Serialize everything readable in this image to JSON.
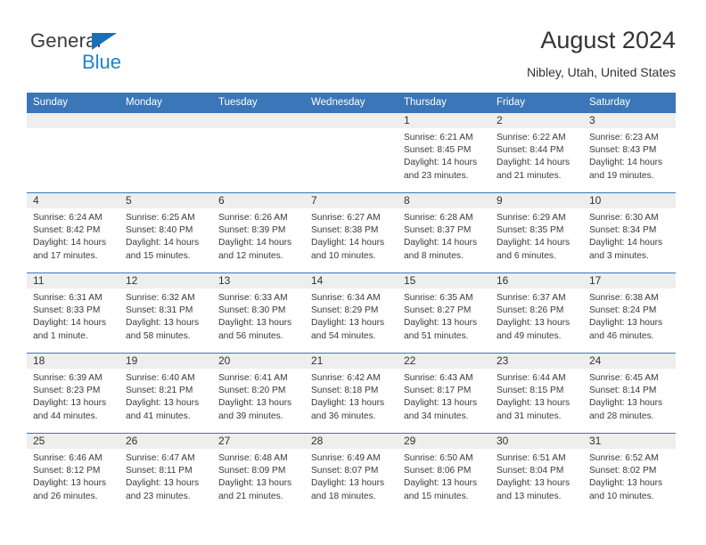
{
  "brand": {
    "name_part1": "General",
    "name_part2": "Blue",
    "flag_color": "#1c6fb5",
    "blue_color": "#2183cd"
  },
  "header": {
    "title": "August 2024",
    "subtitle": "Nibley, Utah, United States"
  },
  "theme": {
    "header_blue": "#3a76b8",
    "daynum_band": "#eeeeee",
    "text": "#333333"
  },
  "weekdays": [
    "Sunday",
    "Monday",
    "Tuesday",
    "Wednesday",
    "Thursday",
    "Friday",
    "Saturday"
  ],
  "weeks": [
    [
      {
        "day": "",
        "lines": []
      },
      {
        "day": "",
        "lines": []
      },
      {
        "day": "",
        "lines": []
      },
      {
        "day": "",
        "lines": []
      },
      {
        "day": "1",
        "lines": [
          "Sunrise: 6:21 AM",
          "Sunset: 8:45 PM",
          "Daylight: 14 hours",
          "and 23 minutes."
        ]
      },
      {
        "day": "2",
        "lines": [
          "Sunrise: 6:22 AM",
          "Sunset: 8:44 PM",
          "Daylight: 14 hours",
          "and 21 minutes."
        ]
      },
      {
        "day": "3",
        "lines": [
          "Sunrise: 6:23 AM",
          "Sunset: 8:43 PM",
          "Daylight: 14 hours",
          "and 19 minutes."
        ]
      }
    ],
    [
      {
        "day": "4",
        "lines": [
          "Sunrise: 6:24 AM",
          "Sunset: 8:42 PM",
          "Daylight: 14 hours",
          "and 17 minutes."
        ]
      },
      {
        "day": "5",
        "lines": [
          "Sunrise: 6:25 AM",
          "Sunset: 8:40 PM",
          "Daylight: 14 hours",
          "and 15 minutes."
        ]
      },
      {
        "day": "6",
        "lines": [
          "Sunrise: 6:26 AM",
          "Sunset: 8:39 PM",
          "Daylight: 14 hours",
          "and 12 minutes."
        ]
      },
      {
        "day": "7",
        "lines": [
          "Sunrise: 6:27 AM",
          "Sunset: 8:38 PM",
          "Daylight: 14 hours",
          "and 10 minutes."
        ]
      },
      {
        "day": "8",
        "lines": [
          "Sunrise: 6:28 AM",
          "Sunset: 8:37 PM",
          "Daylight: 14 hours",
          "and 8 minutes."
        ]
      },
      {
        "day": "9",
        "lines": [
          "Sunrise: 6:29 AM",
          "Sunset: 8:35 PM",
          "Daylight: 14 hours",
          "and 6 minutes."
        ]
      },
      {
        "day": "10",
        "lines": [
          "Sunrise: 6:30 AM",
          "Sunset: 8:34 PM",
          "Daylight: 14 hours",
          "and 3 minutes."
        ]
      }
    ],
    [
      {
        "day": "11",
        "lines": [
          "Sunrise: 6:31 AM",
          "Sunset: 8:33 PM",
          "Daylight: 14 hours",
          "and 1 minute."
        ]
      },
      {
        "day": "12",
        "lines": [
          "Sunrise: 6:32 AM",
          "Sunset: 8:31 PM",
          "Daylight: 13 hours",
          "and 58 minutes."
        ]
      },
      {
        "day": "13",
        "lines": [
          "Sunrise: 6:33 AM",
          "Sunset: 8:30 PM",
          "Daylight: 13 hours",
          "and 56 minutes."
        ]
      },
      {
        "day": "14",
        "lines": [
          "Sunrise: 6:34 AM",
          "Sunset: 8:29 PM",
          "Daylight: 13 hours",
          "and 54 minutes."
        ]
      },
      {
        "day": "15",
        "lines": [
          "Sunrise: 6:35 AM",
          "Sunset: 8:27 PM",
          "Daylight: 13 hours",
          "and 51 minutes."
        ]
      },
      {
        "day": "16",
        "lines": [
          "Sunrise: 6:37 AM",
          "Sunset: 8:26 PM",
          "Daylight: 13 hours",
          "and 49 minutes."
        ]
      },
      {
        "day": "17",
        "lines": [
          "Sunrise: 6:38 AM",
          "Sunset: 8:24 PM",
          "Daylight: 13 hours",
          "and 46 minutes."
        ]
      }
    ],
    [
      {
        "day": "18",
        "lines": [
          "Sunrise: 6:39 AM",
          "Sunset: 8:23 PM",
          "Daylight: 13 hours",
          "and 44 minutes."
        ]
      },
      {
        "day": "19",
        "lines": [
          "Sunrise: 6:40 AM",
          "Sunset: 8:21 PM",
          "Daylight: 13 hours",
          "and 41 minutes."
        ]
      },
      {
        "day": "20",
        "lines": [
          "Sunrise: 6:41 AM",
          "Sunset: 8:20 PM",
          "Daylight: 13 hours",
          "and 39 minutes."
        ]
      },
      {
        "day": "21",
        "lines": [
          "Sunrise: 6:42 AM",
          "Sunset: 8:18 PM",
          "Daylight: 13 hours",
          "and 36 minutes."
        ]
      },
      {
        "day": "22",
        "lines": [
          "Sunrise: 6:43 AM",
          "Sunset: 8:17 PM",
          "Daylight: 13 hours",
          "and 34 minutes."
        ]
      },
      {
        "day": "23",
        "lines": [
          "Sunrise: 6:44 AM",
          "Sunset: 8:15 PM",
          "Daylight: 13 hours",
          "and 31 minutes."
        ]
      },
      {
        "day": "24",
        "lines": [
          "Sunrise: 6:45 AM",
          "Sunset: 8:14 PM",
          "Daylight: 13 hours",
          "and 28 minutes."
        ]
      }
    ],
    [
      {
        "day": "25",
        "lines": [
          "Sunrise: 6:46 AM",
          "Sunset: 8:12 PM",
          "Daylight: 13 hours",
          "and 26 minutes."
        ]
      },
      {
        "day": "26",
        "lines": [
          "Sunrise: 6:47 AM",
          "Sunset: 8:11 PM",
          "Daylight: 13 hours",
          "and 23 minutes."
        ]
      },
      {
        "day": "27",
        "lines": [
          "Sunrise: 6:48 AM",
          "Sunset: 8:09 PM",
          "Daylight: 13 hours",
          "and 21 minutes."
        ]
      },
      {
        "day": "28",
        "lines": [
          "Sunrise: 6:49 AM",
          "Sunset: 8:07 PM",
          "Daylight: 13 hours",
          "and 18 minutes."
        ]
      },
      {
        "day": "29",
        "lines": [
          "Sunrise: 6:50 AM",
          "Sunset: 8:06 PM",
          "Daylight: 13 hours",
          "and 15 minutes."
        ]
      },
      {
        "day": "30",
        "lines": [
          "Sunrise: 6:51 AM",
          "Sunset: 8:04 PM",
          "Daylight: 13 hours",
          "and 13 minutes."
        ]
      },
      {
        "day": "31",
        "lines": [
          "Sunrise: 6:52 AM",
          "Sunset: 8:02 PM",
          "Daylight: 13 hours",
          "and 10 minutes."
        ]
      }
    ]
  ]
}
